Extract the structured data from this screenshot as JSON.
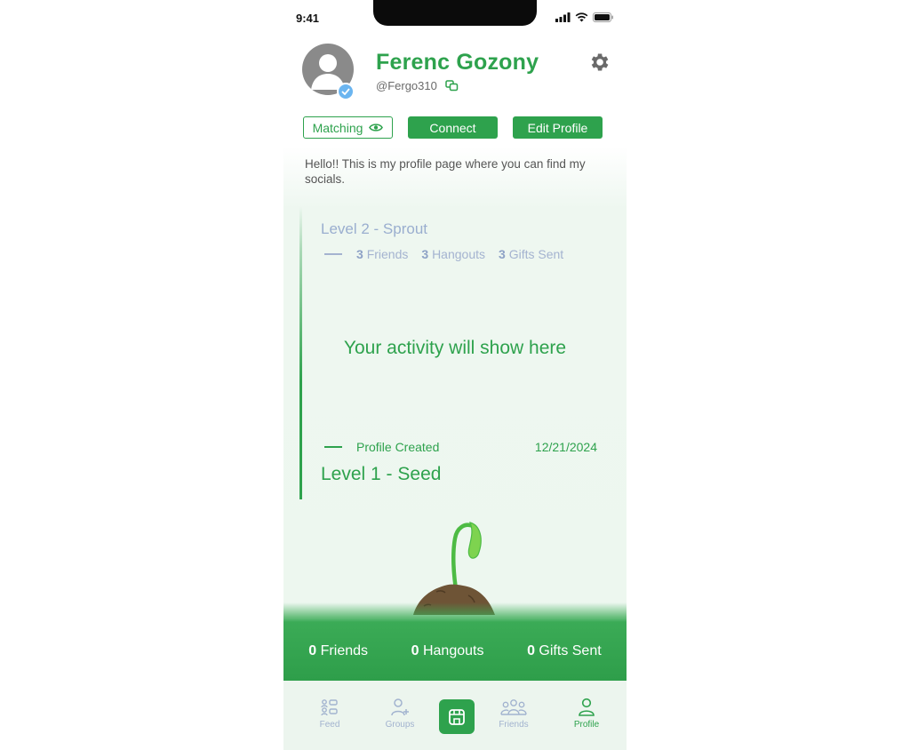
{
  "status_bar": {
    "time": "9:41"
  },
  "profile": {
    "name": "Ferenc Gozony",
    "handle": "@Fergo310",
    "bio": "Hello!! This is my profile page where you can find my socials."
  },
  "actions": {
    "matching_label": "Matching",
    "connect_label": "Connect",
    "edit_label": "Edit Profile"
  },
  "timeline": {
    "current_level": "Level 2 - Sprout",
    "stats": [
      {
        "count": "3",
        "label": "Friends"
      },
      {
        "count": "3",
        "label": "Hangouts"
      },
      {
        "count": "3",
        "label": "Gifts Sent"
      }
    ],
    "empty_message": "Your activity will show here",
    "event_label": "Profile Created",
    "event_date": "12/21/2024",
    "start_level": "Level 1 - Seed"
  },
  "totals": [
    {
      "count": "0",
      "label": "Friends"
    },
    {
      "count": "0",
      "label": "Hangouts"
    },
    {
      "count": "0",
      "label": "Gifts Sent"
    }
  ],
  "nav": {
    "items": [
      {
        "label": "Feed",
        "icon": "feed-icon"
      },
      {
        "label": "Groups",
        "icon": "add-user-icon"
      },
      {
        "label": "",
        "icon": "store-icon"
      },
      {
        "label": "Friends",
        "icon": "friends-icon"
      },
      {
        "label": "Profile",
        "icon": "profile-icon"
      }
    ],
    "active": "Profile"
  },
  "colors": {
    "brand_green": "#2ea24d",
    "muted_blue": "#a2b3cf",
    "verified_blue": "#6bb5f0"
  }
}
